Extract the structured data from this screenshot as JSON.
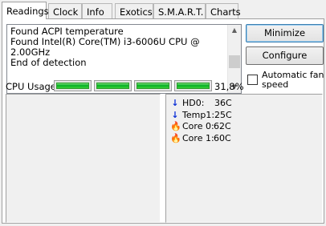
{
  "tabs": [
    {
      "label": "Readings",
      "active": true
    },
    {
      "label": "Clock",
      "active": false
    },
    {
      "label": "Info",
      "active": false
    },
    {
      "label": "Exotics",
      "active": false
    },
    {
      "label": "S.M.A.R.T.",
      "active": false
    },
    {
      "label": "Charts",
      "active": false
    }
  ],
  "log": {
    "lines": [
      "Found ACPI temperature",
      "Found Intel(R) Core(TM) i3-6006U CPU @ 2.00GHz",
      "End of detection"
    ]
  },
  "buttons": {
    "minimize": "Minimize",
    "configure": "Configure"
  },
  "automatic_fan_speed": {
    "label": "Automatic fan speed",
    "checked": false
  },
  "cpu": {
    "label": "CPU Usage",
    "percent": "31,8%",
    "core_count": 4
  },
  "sensors": [
    {
      "name": "HD0:",
      "value": "36C",
      "icon": "arrow-down-icon"
    },
    {
      "name": "Temp1:",
      "value": "25C",
      "icon": "arrow-down-icon"
    },
    {
      "name": "Core 0:",
      "value": "62C",
      "icon": "flame-icon"
    },
    {
      "name": "Core 1:",
      "value": "60C",
      "icon": "flame-icon"
    }
  ],
  "colors": {
    "cpu_bar": "#06b025",
    "cold_icon": "#0b2fd6",
    "hot_icon": "#ff4000"
  }
}
